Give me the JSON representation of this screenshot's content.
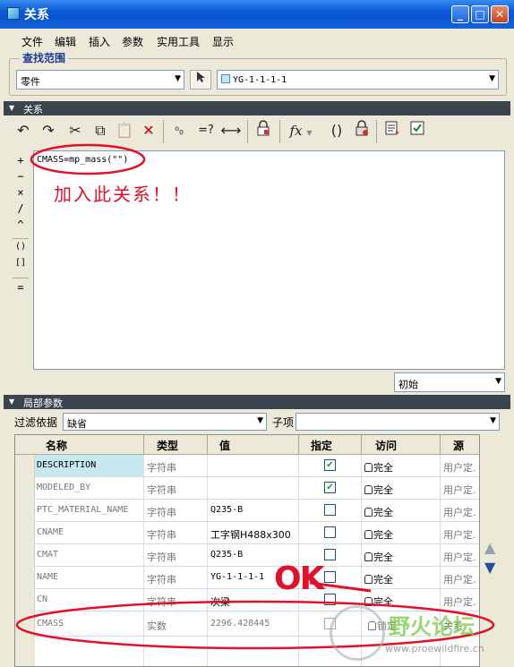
{
  "window": {
    "title": "关系",
    "minimize": "_",
    "maximize": "□",
    "close": "✕"
  },
  "menu": [
    "文件",
    "编辑",
    "插入",
    "参数",
    "实用工具",
    "显示"
  ],
  "search_range": {
    "label": "查找范围",
    "scope_value": "零件",
    "model_value": "YG-1-1-1-1"
  },
  "relations_section": {
    "label": "关系"
  },
  "toolbar": {
    "undo": "↶",
    "redo": "↷",
    "cut": "✂",
    "copy": "⧉",
    "paste": "📋",
    "delete": "✕",
    "units": "⁰₀",
    "eval": "=?",
    "dimension": "⟷",
    "func": "fx",
    "brackets": "()"
  },
  "operators": [
    "+",
    "−",
    "×",
    "/",
    "^",
    "()",
    "[]",
    "="
  ],
  "editor": {
    "code": "CMASS=mp_mass(\"\")"
  },
  "annotations": {
    "add_note": "加入此关系！！",
    "ok_note": "OK"
  },
  "sort_select": {
    "value": "初始"
  },
  "local_params_section": {
    "label": "局部参数"
  },
  "filter": {
    "label": "过滤依据",
    "value": "缺省",
    "sub_label": "子项",
    "sub_value": ""
  },
  "table": {
    "headers": [
      "名称",
      "类型",
      "值",
      "指定",
      "访问",
      "源"
    ],
    "rows": [
      {
        "name": "DESCRIPTION",
        "type": "字符串",
        "value": "",
        "designated": true,
        "access": "完全",
        "source": "用户定."
      },
      {
        "name": "MODELED_BY",
        "type": "字符串",
        "value": "",
        "designated": true,
        "access": "完全",
        "source": "用户定."
      },
      {
        "name": "PTC_MATERIAL_NAME",
        "type": "字符串",
        "value": "Q235-B",
        "designated": false,
        "access": "完全",
        "source": "用户定."
      },
      {
        "name": "CNAME",
        "type": "字符串",
        "value": "工字钢H488x300",
        "designated": false,
        "access": "完全",
        "source": "用户定."
      },
      {
        "name": "CMAT",
        "type": "字符串",
        "value": "Q235-B",
        "designated": false,
        "access": "完全",
        "source": "用户定."
      },
      {
        "name": "NAME",
        "type": "字符串",
        "value": "YG-1-1-1-1",
        "designated": false,
        "access": "完全",
        "source": "用户定."
      },
      {
        "name": "CN",
        "type": "字符串",
        "value": "次梁",
        "designated": false,
        "access": "完全",
        "source": "用户定."
      },
      {
        "name": "CMASS",
        "type": "实数",
        "value": "2296.428445",
        "designated": false,
        "access": "锁定",
        "source": "关系"
      }
    ]
  },
  "watermark": {
    "title": "野火论坛",
    "url": "www.proewildfire.cn"
  },
  "colors": {
    "annotation": "#e3102a",
    "section_bg": "#3b4550",
    "title_bar": "#0a5ad8"
  }
}
